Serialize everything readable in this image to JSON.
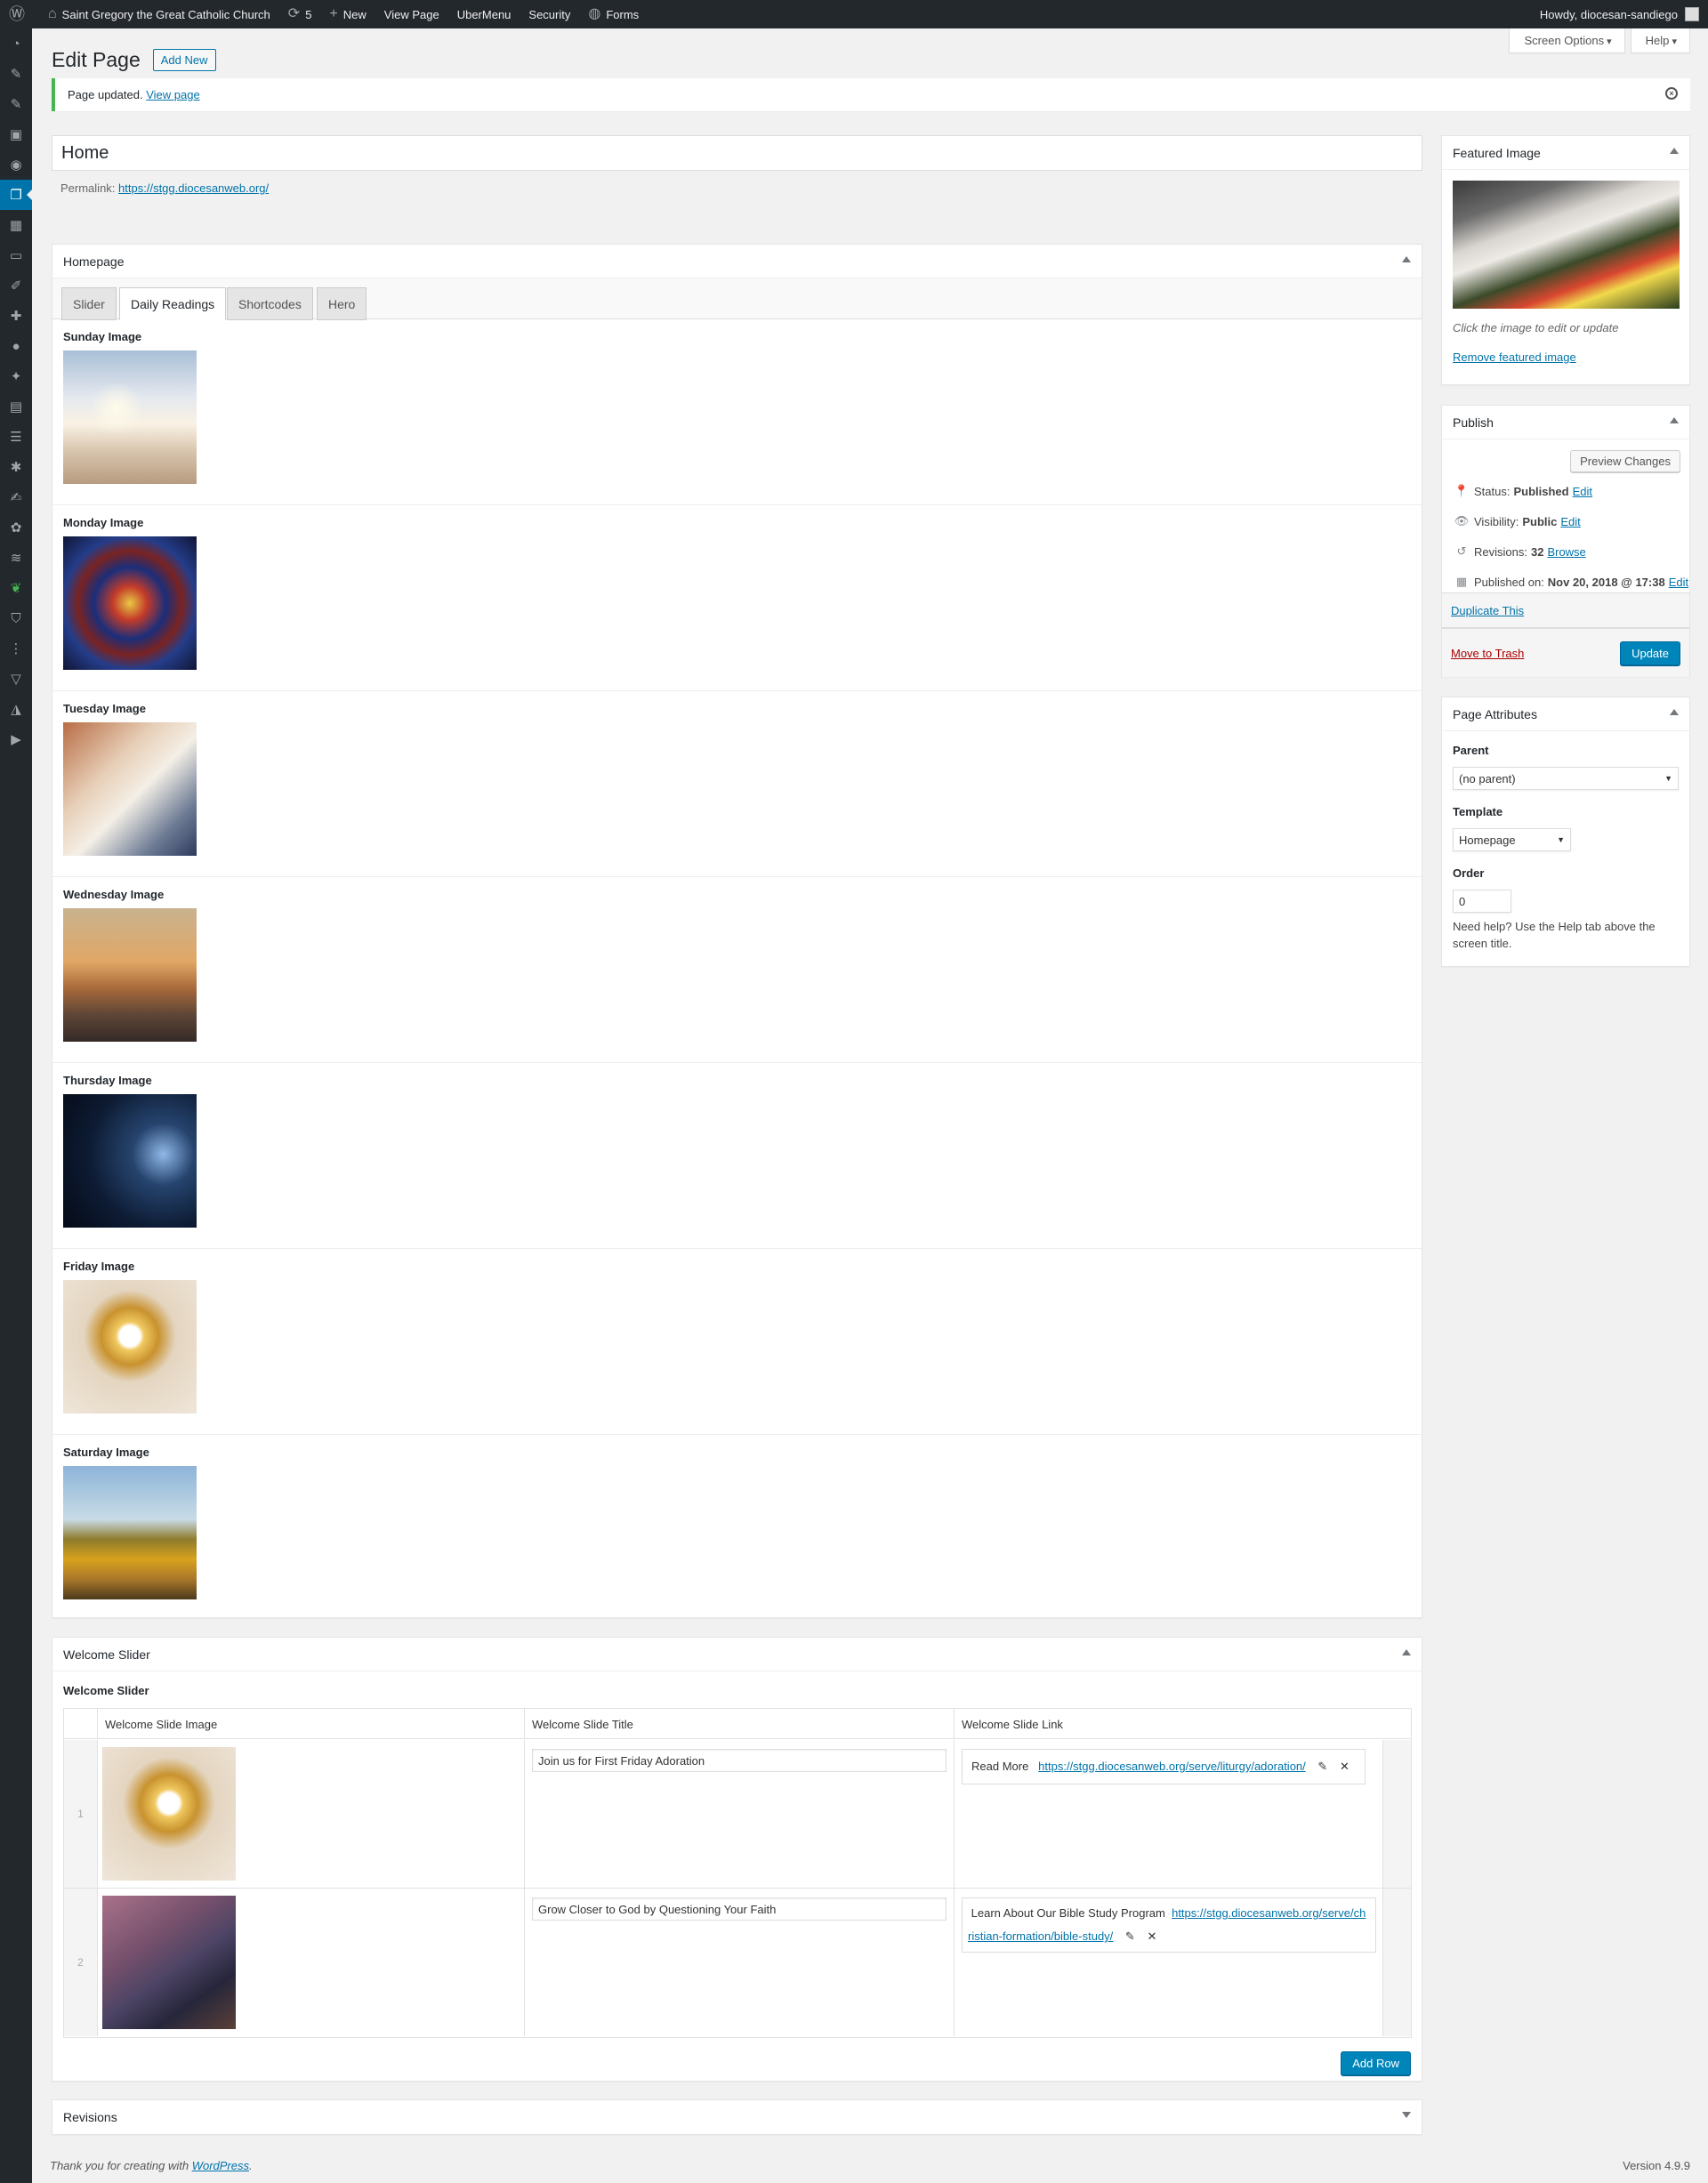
{
  "adminbar": {
    "site_name": "Saint Gregory the Great Catholic Church",
    "updates_count": "5",
    "new_label": "New",
    "view_page_label": "View Page",
    "ubermenu_label": "UberMenu",
    "security_label": "Security",
    "forms_label": "Forms",
    "howdy": "Howdy, diocesan-sandiego"
  },
  "screen_meta": {
    "screen_options": "Screen Options",
    "help": "Help"
  },
  "header": {
    "title": "Edit Page",
    "add_new": "Add New"
  },
  "notice": {
    "text": "Page updated.",
    "link": "View page"
  },
  "post": {
    "title": "Home",
    "permalink_label": "Permalink:",
    "permalink_url": "https://stgg.diocesanweb.org/"
  },
  "homepage_box": {
    "title": "Homepage",
    "tabs": [
      "Slider",
      "Daily Readings",
      "Shortcodes",
      "Hero"
    ],
    "active_tab": "Daily Readings",
    "days": [
      {
        "label": "Sunday Image"
      },
      {
        "label": "Monday Image"
      },
      {
        "label": "Tuesday Image"
      },
      {
        "label": "Wednesday Image"
      },
      {
        "label": "Thursday Image"
      },
      {
        "label": "Friday Image"
      },
      {
        "label": "Saturday Image"
      }
    ]
  },
  "welcome_box": {
    "title": "Welcome Slider",
    "subtitle": "Welcome Slider",
    "columns": [
      "Welcome Slide Image",
      "Welcome Slide Title",
      "Welcome Slide Link"
    ],
    "rows": [
      {
        "order": "1",
        "title": "Join us for First Friday Adoration",
        "link_text": "Read More",
        "link_url": "https://stgg.diocesanweb.org/serve/liturgy/adoration/"
      },
      {
        "order": "2",
        "title": "Grow Closer to God by Questioning Your Faith",
        "link_text": "Learn About Our Bible Study Program",
        "link_url_part1": "https://stgg.diocesanweb.org/serve/ch",
        "link_url_part2": "ristian-formation/bible-study/"
      }
    ],
    "add_row": "Add Row"
  },
  "revisions_box": {
    "title": "Revisions"
  },
  "featured_box": {
    "title": "Featured Image",
    "hint": "Click the image to edit or update",
    "remove": "Remove featured image"
  },
  "publish_box": {
    "title": "Publish",
    "preview": "Preview Changes",
    "status_label": "Status:",
    "status_value": "Published",
    "visibility_label": "Visibility:",
    "visibility_value": "Public",
    "revisions_label": "Revisions:",
    "revisions_value": "32",
    "browse": "Browse",
    "published_label": "Published on:",
    "published_value": "Nov 20, 2018 @ 17:38",
    "edit": "Edit",
    "duplicate": "Duplicate This",
    "trash": "Move to Trash",
    "update": "Update"
  },
  "attributes_box": {
    "title": "Page Attributes",
    "parent_label": "Parent",
    "parent_value": "(no parent)",
    "template_label": "Template",
    "template_value": "Homepage",
    "order_label": "Order",
    "order_value": "0",
    "help": "Need help? Use the Help tab above the screen title."
  },
  "footer": {
    "thanks": "Thank you for creating with",
    "wp_link": "WordPress",
    "version": "Version 4.9.9"
  },
  "colors": {
    "adminbar_bg": "#23282d",
    "accent": "#0073aa",
    "primary_button": "#0085ba",
    "notice_success": "#46b450",
    "trash": "#a00"
  }
}
